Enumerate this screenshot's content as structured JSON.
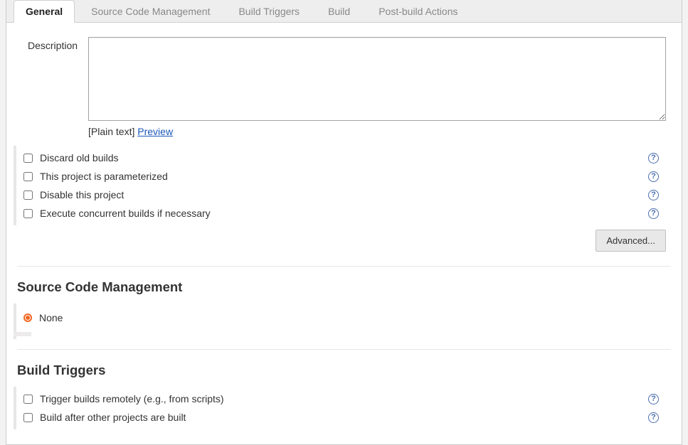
{
  "tabs": {
    "general": "General",
    "scm": "Source Code Management",
    "triggers": "Build Triggers",
    "build": "Build",
    "post": "Post-build Actions"
  },
  "general": {
    "description_label": "Description",
    "description_value": "",
    "plain_text": "[Plain text] ",
    "preview": "Preview",
    "checks": {
      "discard": "Discard old builds",
      "parameterized": "This project is parameterized",
      "disable": "Disable this project",
      "concurrent": "Execute concurrent builds if necessary"
    },
    "advanced": "Advanced..."
  },
  "scm": {
    "title": "Source Code Management",
    "none": "None"
  },
  "triggers": {
    "title": "Build Triggers",
    "remote": "Trigger builds remotely (e.g., from scripts)",
    "after": "Build after other projects are built"
  }
}
